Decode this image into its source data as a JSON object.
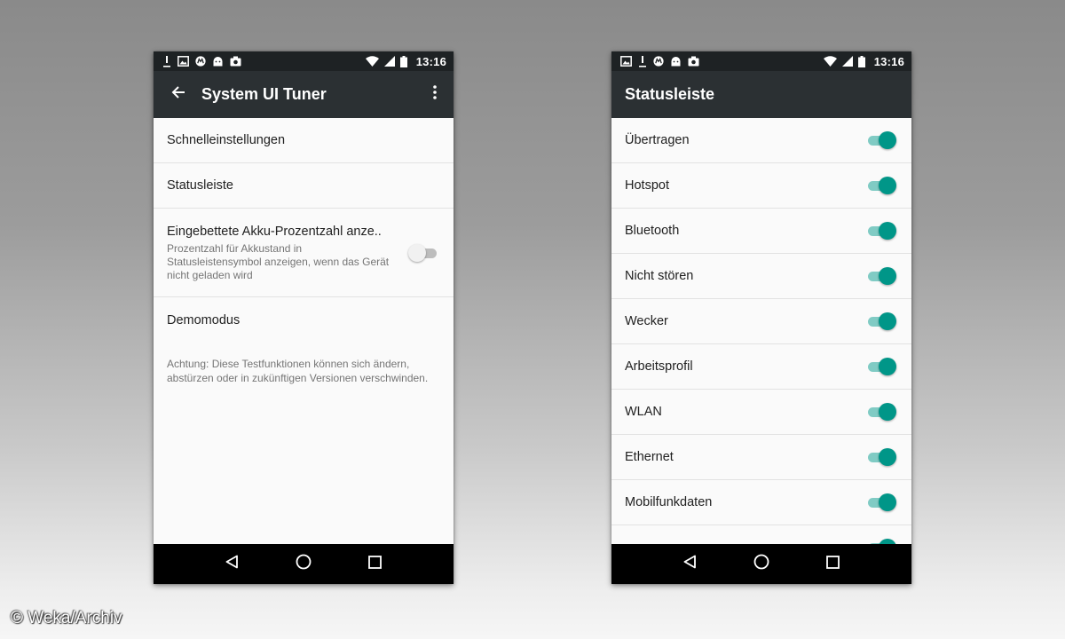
{
  "left_phone": {
    "status_bar": {
      "time": "13:16",
      "icons": [
        "download-icon",
        "image-icon",
        "motorola-icon",
        "android-icon",
        "camera-icon",
        "wifi-icon",
        "signal-icon",
        "battery-icon"
      ]
    },
    "app_bar": {
      "title": "System UI Tuner",
      "back_icon": "arrow-back-icon",
      "menu_icon": "more-vert-icon"
    },
    "items": [
      {
        "label": "Schnelleinstellungen"
      },
      {
        "label": "Statusleiste"
      },
      {
        "label": "Eingebettete Akku-Prozentzahl anze..",
        "summary": "Prozentzahl für Akkustand in Statusleistensymbol anzeigen, wenn das Gerät nicht geladen wird",
        "switch": false
      },
      {
        "label": "Demomodus"
      }
    ],
    "note": "Achtung: Diese Testfunktionen können sich ändern, abstürzen oder in zukünftigen Versionen verschwinden."
  },
  "right_phone": {
    "status_bar": {
      "time": "13:16",
      "icons": [
        "image-icon",
        "download-icon",
        "motorola-icon",
        "android-icon",
        "camera-icon",
        "wifi-icon",
        "signal-icon",
        "battery-icon"
      ]
    },
    "app_bar": {
      "title": "Statusleiste"
    },
    "items": [
      {
        "label": "Übertragen",
        "switch": true
      },
      {
        "label": "Hotspot",
        "switch": true
      },
      {
        "label": "Bluetooth",
        "switch": true
      },
      {
        "label": "Nicht stören",
        "switch": true
      },
      {
        "label": "Wecker",
        "switch": true
      },
      {
        "label": "Arbeitsprofil",
        "switch": true
      },
      {
        "label": "WLAN",
        "switch": true
      },
      {
        "label": "Ethernet",
        "switch": true
      },
      {
        "label": "Mobilfunkdaten",
        "switch": true
      },
      {
        "label": "",
        "switch": true
      }
    ]
  },
  "nav_bar": {
    "icons": [
      "back-triangle-icon",
      "home-circle-icon",
      "recents-square-icon"
    ]
  },
  "colors": {
    "accent": "#009688",
    "accent_track": "#80cbc4",
    "app_bar": "#2b3033",
    "status_bar": "#1e2224"
  },
  "watermark": "© Weka/Archiv"
}
